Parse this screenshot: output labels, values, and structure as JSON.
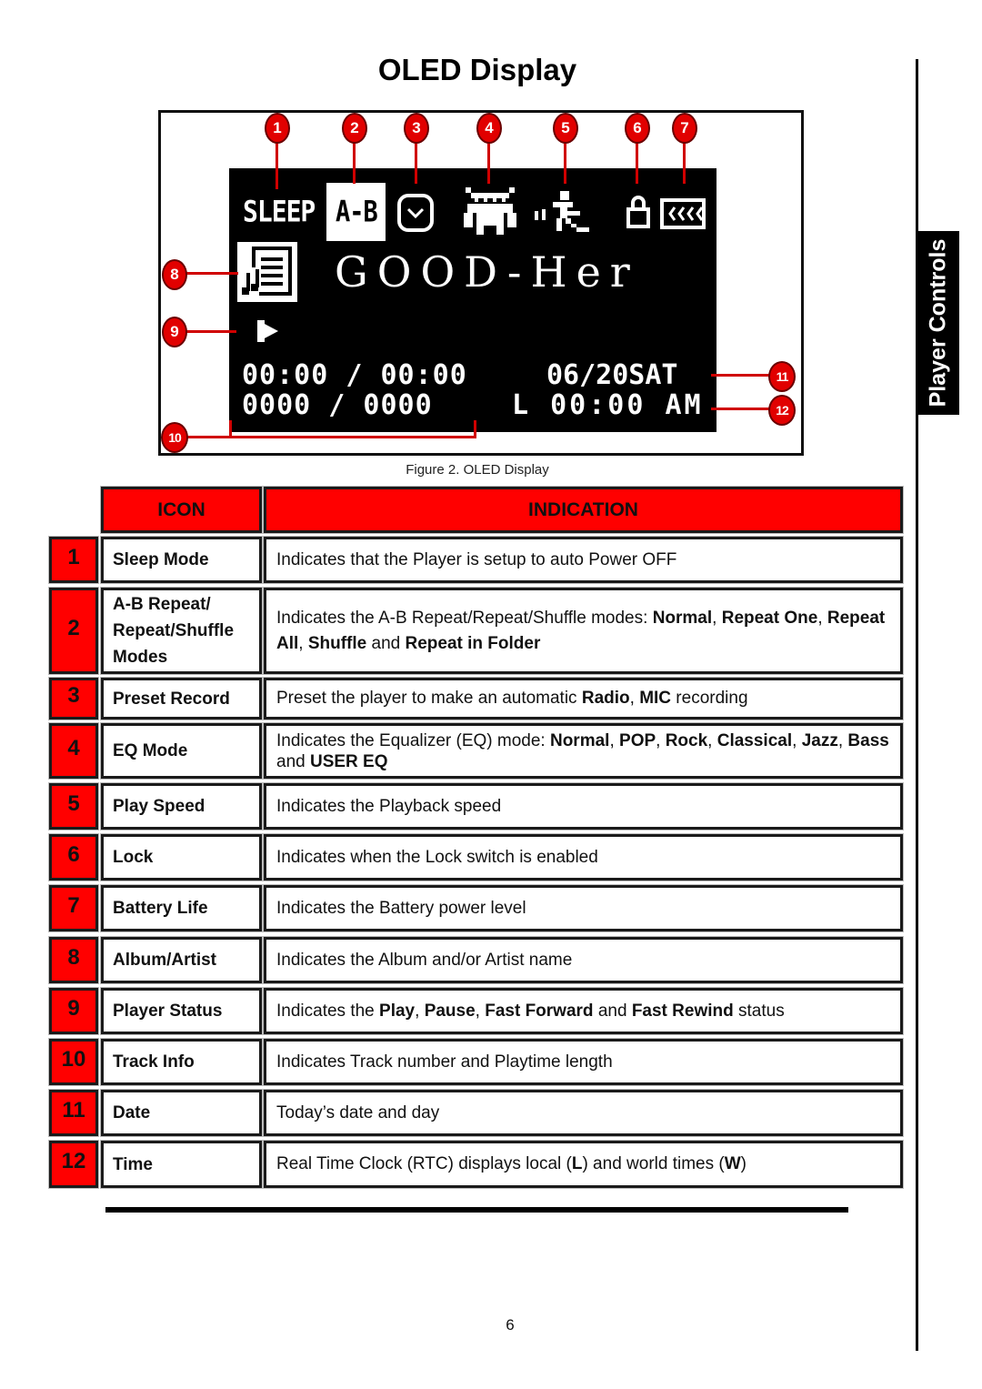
{
  "page": {
    "title": "OLED Display",
    "side_tab": "Player Controls",
    "figure_caption": "Figure 2. OLED Display",
    "page_number": "6"
  },
  "oled": {
    "sleep": "SLEEP",
    "ab": "A-B",
    "track_title": "GOOD-Her",
    "play_time": "00:00 / 00:00",
    "track_count": "0000 / 0000",
    "date": "06/20SAT",
    "time": "L 00:00 AM",
    "icons": [
      "sleep-indicator",
      "ab-repeat-indicator",
      "preset-record-icon",
      "eq-mode-icon",
      "play-speed-icon",
      "lock-icon",
      "battery-icon",
      "album-artist-icon",
      "play-status-icon"
    ]
  },
  "callouts": [
    "1",
    "2",
    "3",
    "4",
    "5",
    "6",
    "7",
    "8",
    "9",
    "10",
    "11",
    "12"
  ],
  "table": {
    "headers": {
      "icon": "ICON",
      "indication": "INDICATION"
    },
    "colors": {
      "header_bg": "#ff0000",
      "number_bg": "#ff0000"
    },
    "rows": [
      {
        "num": "1",
        "icon": "Sleep Mode",
        "indication": [
          {
            "t": "Indicates that the Player is setup to auto Power OFF",
            "b": false
          }
        ]
      },
      {
        "num": "2",
        "icon": "A-B Repeat/ Repeat/Shuffle Modes",
        "indication": [
          {
            "t": "Indicates the A-B Repeat/Repeat/Shuffle modes: ",
            "b": false
          },
          {
            "t": "Normal",
            "b": true
          },
          {
            "t": ", ",
            "b": false
          },
          {
            "t": "Repeat One",
            "b": true
          },
          {
            "t": ", ",
            "b": false
          },
          {
            "t": "Repeat All",
            "b": true
          },
          {
            "t": ", ",
            "b": false
          },
          {
            "t": "Shuffle",
            "b": true
          },
          {
            "t": " and ",
            "b": false
          },
          {
            "t": "Repeat in Folder",
            "b": true
          }
        ]
      },
      {
        "num": "3",
        "icon": "Preset Record",
        "indication": [
          {
            "t": "Preset the player to make an automatic ",
            "b": false
          },
          {
            "t": "Radio",
            "b": true
          },
          {
            "t": ", ",
            "b": false
          },
          {
            "t": "MIC",
            "b": true
          },
          {
            "t": " recording",
            "b": false
          }
        ]
      },
      {
        "num": "4",
        "icon": "EQ Mode",
        "indication": [
          {
            "t": "Indicates the Equalizer (EQ) mode: ",
            "b": false
          },
          {
            "t": "Normal",
            "b": true
          },
          {
            "t": ", ",
            "b": false
          },
          {
            "t": "POP",
            "b": true
          },
          {
            "t": ", ",
            "b": false
          },
          {
            "t": "Rock",
            "b": true
          },
          {
            "t": ", ",
            "b": false
          },
          {
            "t": "Classical",
            "b": true
          },
          {
            "t": ", ",
            "b": false
          },
          {
            "t": "Jazz",
            "b": true
          },
          {
            "t": ", ",
            "b": false
          },
          {
            "t": "Bass",
            "b": true
          },
          {
            "t": " and ",
            "b": false
          },
          {
            "t": "USER EQ",
            "b": true
          }
        ]
      },
      {
        "num": "5",
        "icon": "Play Speed",
        "indication": [
          {
            "t": "Indicates the Playback speed",
            "b": false
          }
        ]
      },
      {
        "num": "6",
        "icon": "Lock",
        "indication": [
          {
            "t": "Indicates when the Lock switch is enabled",
            "b": false
          }
        ]
      },
      {
        "num": "7",
        "icon": "Battery Life",
        "indication": [
          {
            "t": "Indicates the Battery power level",
            "b": false
          }
        ]
      },
      {
        "num": "8",
        "icon": "Album/Artist",
        "indication": [
          {
            "t": "Indicates the Album and/or Artist name",
            "b": false
          }
        ]
      },
      {
        "num": "9",
        "icon": "Player Status",
        "indication": [
          {
            "t": "Indicates the ",
            "b": false
          },
          {
            "t": "Play",
            "b": true
          },
          {
            "t": ", ",
            "b": false
          },
          {
            "t": "Pause",
            "b": true
          },
          {
            "t": ", ",
            "b": false
          },
          {
            "t": "Fast Forward",
            "b": true
          },
          {
            "t": " and ",
            "b": false
          },
          {
            "t": "Fast Rewind",
            "b": true
          },
          {
            "t": " status",
            "b": false
          }
        ]
      },
      {
        "num": "10",
        "icon": "Track Info",
        "indication": [
          {
            "t": "Indicates Track number and Playtime length",
            "b": false
          }
        ]
      },
      {
        "num": "11",
        "icon": "Date",
        "indication": [
          {
            "t": "Today’s date and day",
            "b": false
          }
        ]
      },
      {
        "num": "12",
        "icon": "Time",
        "indication": [
          {
            "t": "Real Time Clock (RTC) displays local (",
            "b": false
          },
          {
            "t": "L",
            "b": true
          },
          {
            "t": ") and world times (",
            "b": false
          },
          {
            "t": "W",
            "b": true
          },
          {
            "t": ")",
            "b": false
          }
        ]
      }
    ]
  }
}
